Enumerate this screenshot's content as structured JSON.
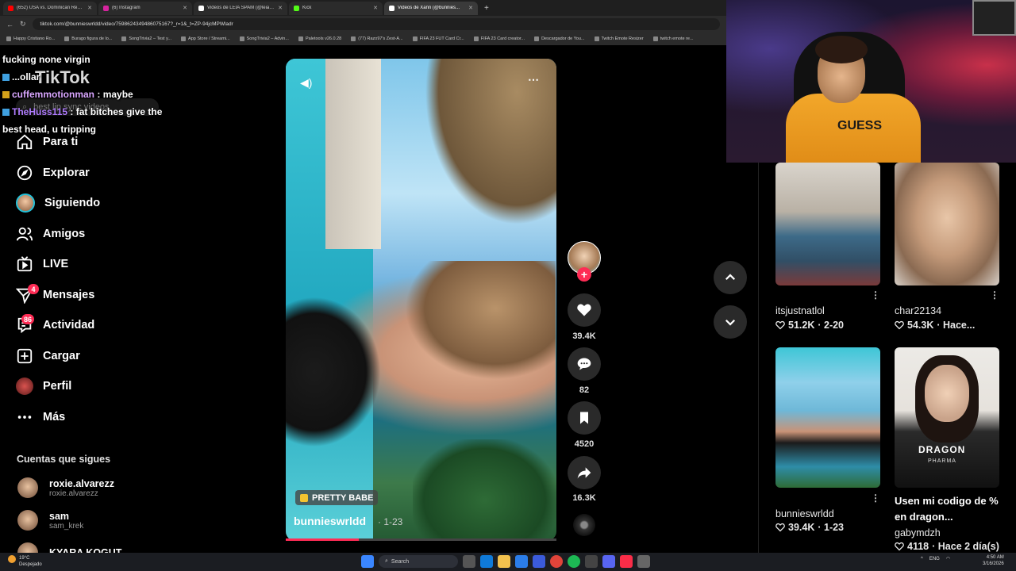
{
  "browser": {
    "tabs": [
      {
        "label": "(652) USA vs. Dominican Repu...",
        "color": "#ff0000",
        "active": false
      },
      {
        "label": "(6) Instagram",
        "color": "#d6249f",
        "active": false
      },
      {
        "label": "Videos de LEIA SPAM (@leiana...",
        "color": "#ffffff",
        "active": false
      },
      {
        "label": "Kick",
        "color": "#53fc18",
        "active": false
      },
      {
        "label": "Videos de Xann (@bunnies...",
        "color": "#ffffff",
        "active": true
      }
    ],
    "new_tab": "+",
    "close": "✕",
    "url": "tiktok.com/@bunnieswrldd/video/7598624349486075167?_r=1&_t=ZP-94jcMPWladr",
    "bookmarks": [
      "Happy Cristiano Ro...",
      "Burago figura de lo...",
      "SongTrivia2 – Test y...",
      "App Store / Streami...",
      "SongTrivia2 – Advin...",
      "Paletools v26.0.28",
      "(77) Razo97's Zest-A...",
      "FIFA 23 FUT Card Cr...",
      "FIFA 23 Card creator...",
      "Descargador de You...",
      "Twitch Emote Resizer",
      "twitch emote re..."
    ]
  },
  "chat": [
    {
      "user": "",
      "text": "fucking none virgin"
    },
    {
      "user": "",
      "text": "...ollar"
    },
    {
      "user": "cuffemmotionman",
      "text": ": maybe"
    },
    {
      "user": "TheHuss115",
      "text": ": fat bitches give the best head, u tripping"
    }
  ],
  "sidebar": {
    "logo": "TikTok",
    "search_placeholder": "best lip sync videos",
    "items": [
      {
        "label": "Para ti",
        "icon": "home-icon"
      },
      {
        "label": "Explorar",
        "icon": "compass-icon"
      },
      {
        "label": "Siguiendo",
        "icon": "avatar"
      },
      {
        "label": "Amigos",
        "icon": "friends-icon"
      },
      {
        "label": "LIVE",
        "icon": "live-icon"
      },
      {
        "label": "Mensajes",
        "icon": "messages-icon"
      },
      {
        "label": "Actividad",
        "icon": "activity-icon"
      },
      {
        "label": "Cargar",
        "icon": "upload-icon"
      },
      {
        "label": "Perfil",
        "icon": "profile-icon"
      },
      {
        "label": "Más",
        "icon": "more-icon"
      }
    ],
    "messages_badge": "4",
    "activity_badge": "86",
    "following_title": "Cuentas que sigues",
    "accounts": [
      {
        "name": "roxie.alvarezz",
        "handle": "roxie.alvarezz"
      },
      {
        "name": "sam",
        "handle": "sam_krek"
      },
      {
        "name": "KYARA KOGUT",
        "handle": ""
      }
    ]
  },
  "video": {
    "tag": "PRETTY BABE",
    "author": "bunnieswrldd",
    "date": "· 1-23",
    "progress": 0.27,
    "likes": "39.4K",
    "comments": "82",
    "saves": "4520",
    "shares": "16.3K"
  },
  "grid": [
    {
      "name": "itsjustnatlol",
      "title": "",
      "likes": "51.2K",
      "date": "· 2-20"
    },
    {
      "name": "char22134",
      "title": "",
      "likes": "54.3K",
      "date": "· Hace..."
    },
    {
      "name": "bunnieswrldd",
      "title": "",
      "likes": "39.4K",
      "date": "· 1-23"
    },
    {
      "name": "gabymdzh",
      "title": "Usen mi codigo de % en dragon...",
      "likes": "4118",
      "date": "· Hace 2 día(s)"
    }
  ],
  "thumb4_text": {
    "line1": "DRAGON",
    "line2": "PHARMA"
  },
  "webcam": {
    "shirt_text": "GUESS"
  },
  "taskbar": {
    "weather_temp": "19°C",
    "weather_desc": "Despejado",
    "search": "Search",
    "lang": "ENG",
    "time": "4:50 AM",
    "date": "3/16/2026"
  },
  "colors": {
    "accent": "#fe2c55",
    "background": "#000000"
  }
}
